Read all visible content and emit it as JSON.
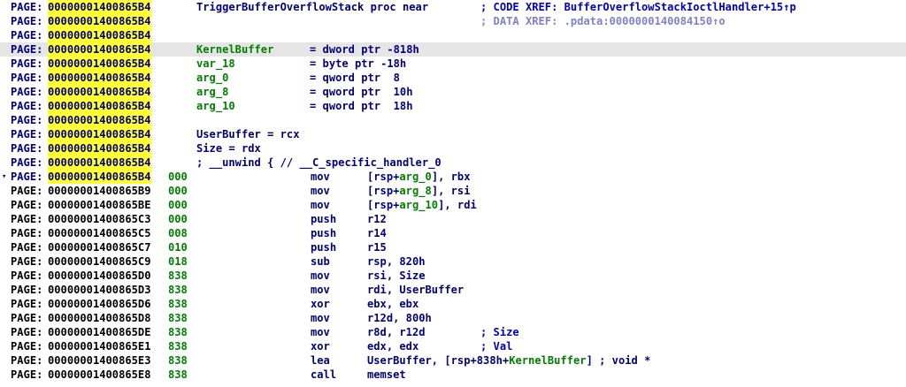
{
  "segment": "PAGE:",
  "rows": [
    {
      "addr": "00000001400865B4",
      "label": "TriggerBufferOverflowStack proc near",
      "comment": "; CODE XREF: BufferOverflowStackIoctlHandler+15↑p"
    },
    {
      "addr": "00000001400865B4",
      "comment": "; DATA XREF: .pdata:0000000140084150↑o"
    },
    {
      "addr": "00000001400865B4"
    },
    {
      "addr": "00000001400865B4",
      "label": "KernelBuffer",
      "eq": "= dword ptr -818h"
    },
    {
      "addr": "00000001400865B4",
      "label": "var_18",
      "eq": "= byte ptr -18h"
    },
    {
      "addr": "00000001400865B4",
      "label": "arg_0",
      "eq": "= qword ptr  8"
    },
    {
      "addr": "00000001400865B4",
      "label": "arg_8",
      "eq": "= qword ptr  10h"
    },
    {
      "addr": "00000001400865B4",
      "label": "arg_10",
      "eq": "= qword ptr  18h"
    },
    {
      "addr": "00000001400865B4"
    },
    {
      "addr": "00000001400865B4",
      "label": "UserBuffer = rcx"
    },
    {
      "addr": "00000001400865B4",
      "label": "Size = rdx"
    },
    {
      "addr": "00000001400865B4",
      "label": "; __unwind { // __C_specific_handler_0"
    },
    {
      "addr": "00000001400865B4",
      "sp": "000",
      "mn": "mov",
      "op_pre": "[rsp+",
      "op_var": "arg_0",
      "op_post": "], rbx"
    },
    {
      "addr": "00000001400865B9",
      "sp": "000",
      "mn": "mov",
      "op_pre": "[rsp+",
      "op_var": "arg_8",
      "op_post": "], rsi"
    },
    {
      "addr": "00000001400865BE",
      "sp": "000",
      "mn": "mov",
      "op_pre": "[rsp+",
      "op_var": "arg_10",
      "op_post": "], rdi"
    },
    {
      "addr": "00000001400865C3",
      "sp": "000",
      "mn": "push",
      "op_pre": "r12"
    },
    {
      "addr": "00000001400865C5",
      "sp": "008",
      "mn": "push",
      "op_pre": "r14"
    },
    {
      "addr": "00000001400865C7",
      "sp": "010",
      "mn": "push",
      "op_pre": "r15"
    },
    {
      "addr": "00000001400865C9",
      "sp": "018",
      "mn": "sub",
      "op_pre": "rsp, 820h"
    },
    {
      "addr": "00000001400865D0",
      "sp": "838",
      "mn": "mov",
      "op_pre": "rsi, Size"
    },
    {
      "addr": "00000001400865D3",
      "sp": "838",
      "mn": "mov",
      "op_pre": "rdi, UserBuffer"
    },
    {
      "addr": "00000001400865D6",
      "sp": "838",
      "mn": "xor",
      "op_pre": "ebx, ebx"
    },
    {
      "addr": "00000001400865D8",
      "sp": "838",
      "mn": "mov",
      "op_pre": "r12d, 800h"
    },
    {
      "addr": "00000001400865DE",
      "sp": "838",
      "mn": "mov",
      "op_pre": "r8d, r12d",
      "comment": "; Size"
    },
    {
      "addr": "00000001400865E1",
      "sp": "838",
      "mn": "xor",
      "op_pre": "edx, edx",
      "comment": "; Val"
    },
    {
      "addr": "00000001400865E3",
      "sp": "838",
      "mn": "lea",
      "op_pre": "UserBuffer, [rsp+838h+",
      "op_var": "KernelBuffer",
      "op_post": "] ; void *"
    },
    {
      "addr": "00000001400865E8",
      "sp": "838",
      "mn": "call",
      "op_pre": "memset"
    }
  ]
}
